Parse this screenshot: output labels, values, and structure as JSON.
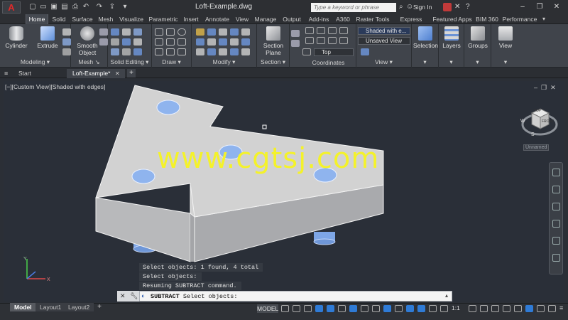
{
  "app": {
    "title": "Loft-Example.dwg",
    "search_placeholder": "Type a keyword or phrase",
    "sign_in": "Sign In",
    "logo": "A"
  },
  "colors": {
    "accent_blue": "#2f7bd6",
    "watermark": "#f4f22a",
    "model_face": "#d2d2d2",
    "hole_fill": "#8fb4ee"
  },
  "ribbon_tabs": [
    "Home",
    "Solid",
    "Surface",
    "Mesh",
    "Visualize",
    "Parametric",
    "Insert",
    "Annotate",
    "View",
    "Manage",
    "Output",
    "Add-ins",
    "A360",
    "Raster Tools",
    "Express Tools",
    "Featured Apps",
    "BIM 360",
    "Performance"
  ],
  "ribbon": {
    "modeling": {
      "title": "Modeling",
      "cylinder": "Cylinder",
      "extrude": "Extrude"
    },
    "mesh": {
      "title": "Mesh",
      "smooth_object": "Smooth\nObject"
    },
    "solid_editing": {
      "title": "Solid Editing"
    },
    "draw": {
      "title": "Draw"
    },
    "modify": {
      "title": "Modify"
    },
    "section": {
      "title": "Section",
      "section_plane": "Section\nPlane"
    },
    "coordinates": {
      "title": "Coordinates",
      "view_dd": "Top"
    },
    "view": {
      "title": "View",
      "visual_style": "Shaded with e...",
      "saved_view": "Unsaved View"
    },
    "selection": {
      "title": "Selection"
    },
    "layers": {
      "title": "Layers"
    },
    "groups": {
      "title": "Groups"
    },
    "view_btn": {
      "title": "View"
    }
  },
  "file_tabs": [
    "Start",
    "Loft-Example*"
  ],
  "viewport": {
    "label": "[−][Custom View][Shaded with edges]",
    "viewcube": {
      "top": "TOP",
      "front": "FRONT",
      "west": "W",
      "south": "S"
    },
    "named_view": "Unnamed"
  },
  "watermark": "www.cgtsj.com",
  "command": {
    "history": [
      "Select objects: 1 found, 4 total",
      "Select objects:",
      "Resuming SUBTRACT command."
    ],
    "current": "SUBTRACT",
    "prompt": "Select objects:"
  },
  "layout_tabs": [
    "Model",
    "Layout1",
    "Layout2"
  ],
  "status": {
    "model": "MODEL",
    "scale": "1:1"
  }
}
